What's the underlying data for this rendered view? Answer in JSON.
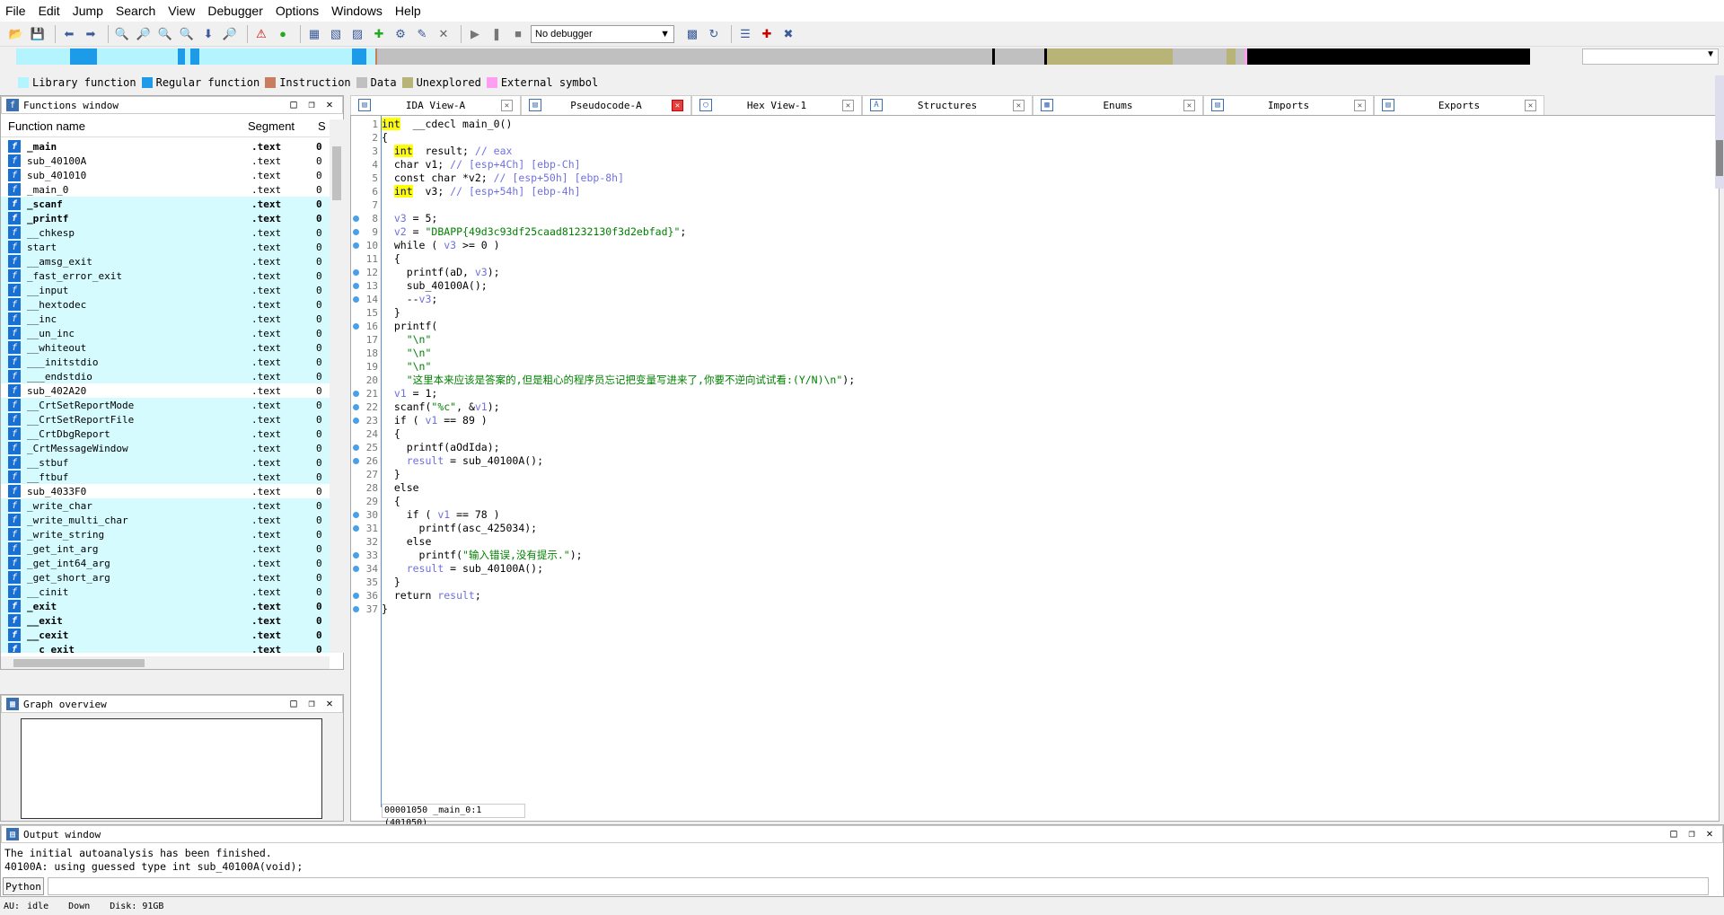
{
  "menubar": [
    "File",
    "Edit",
    "Jump",
    "Search",
    "View",
    "Debugger",
    "Options",
    "Windows",
    "Help"
  ],
  "toolbar": {
    "debugger_select": "No debugger"
  },
  "legend": [
    {
      "label": "Library function",
      "color": "#b4f4ff"
    },
    {
      "label": "Regular function",
      "color": "#1e9be8"
    },
    {
      "label": "Instruction",
      "color": "#c87e5e"
    },
    {
      "label": "Data",
      "color": "#c0c0c0"
    },
    {
      "label": "Unexplored",
      "color": "#b8b478"
    },
    {
      "label": "External symbol",
      "color": "#ff9ef0"
    }
  ],
  "functions_window": {
    "title": "Functions window",
    "col_name": "Function name",
    "col_segment": "Segment",
    "col_s": "S",
    "rows": [
      {
        "name": "_main",
        "seg": ".text",
        "s": "0",
        "lib": false,
        "bold": true
      },
      {
        "name": "sub_40100A",
        "seg": ".text",
        "s": "0",
        "lib": false,
        "bold": false
      },
      {
        "name": "sub_401010",
        "seg": ".text",
        "s": "0",
        "lib": false,
        "bold": false
      },
      {
        "name": "_main_0",
        "seg": ".text",
        "s": "0",
        "lib": false,
        "bold": false
      },
      {
        "name": "_scanf",
        "seg": ".text",
        "s": "0",
        "lib": true,
        "bold": true
      },
      {
        "name": "_printf",
        "seg": ".text",
        "s": "0",
        "lib": true,
        "bold": true
      },
      {
        "name": "__chkesp",
        "seg": ".text",
        "s": "0",
        "lib": true,
        "bold": false
      },
      {
        "name": "start",
        "seg": ".text",
        "s": "0",
        "lib": true,
        "bold": false
      },
      {
        "name": "__amsg_exit",
        "seg": ".text",
        "s": "0",
        "lib": true,
        "bold": false
      },
      {
        "name": "_fast_error_exit",
        "seg": ".text",
        "s": "0",
        "lib": true,
        "bold": false
      },
      {
        "name": "__input",
        "seg": ".text",
        "s": "0",
        "lib": true,
        "bold": false
      },
      {
        "name": "__hextodec",
        "seg": ".text",
        "s": "0",
        "lib": true,
        "bold": false
      },
      {
        "name": "__inc",
        "seg": ".text",
        "s": "0",
        "lib": true,
        "bold": false
      },
      {
        "name": "__un_inc",
        "seg": ".text",
        "s": "0",
        "lib": true,
        "bold": false
      },
      {
        "name": "__whiteout",
        "seg": ".text",
        "s": "0",
        "lib": true,
        "bold": false
      },
      {
        "name": "___initstdio",
        "seg": ".text",
        "s": "0",
        "lib": true,
        "bold": false
      },
      {
        "name": "___endstdio",
        "seg": ".text",
        "s": "0",
        "lib": true,
        "bold": false
      },
      {
        "name": "sub_402A20",
        "seg": ".text",
        "s": "0",
        "lib": false,
        "bold": false
      },
      {
        "name": "__CrtSetReportMode",
        "seg": ".text",
        "s": "0",
        "lib": true,
        "bold": false
      },
      {
        "name": "__CrtSetReportFile",
        "seg": ".text",
        "s": "0",
        "lib": true,
        "bold": false
      },
      {
        "name": "__CrtDbgReport",
        "seg": ".text",
        "s": "0",
        "lib": true,
        "bold": false
      },
      {
        "name": "_CrtMessageWindow",
        "seg": ".text",
        "s": "0",
        "lib": true,
        "bold": false
      },
      {
        "name": "__stbuf",
        "seg": ".text",
        "s": "0",
        "lib": true,
        "bold": false
      },
      {
        "name": "__ftbuf",
        "seg": ".text",
        "s": "0",
        "lib": true,
        "bold": false
      },
      {
        "name": "sub_4033F0",
        "seg": ".text",
        "s": "0",
        "lib": false,
        "bold": false
      },
      {
        "name": "_write_char",
        "seg": ".text",
        "s": "0",
        "lib": true,
        "bold": false
      },
      {
        "name": "_write_multi_char",
        "seg": ".text",
        "s": "0",
        "lib": true,
        "bold": false
      },
      {
        "name": "_write_string",
        "seg": ".text",
        "s": "0",
        "lib": true,
        "bold": false
      },
      {
        "name": "_get_int_arg",
        "seg": ".text",
        "s": "0",
        "lib": true,
        "bold": false
      },
      {
        "name": "_get_int64_arg",
        "seg": ".text",
        "s": "0",
        "lib": true,
        "bold": false
      },
      {
        "name": "_get_short_arg",
        "seg": ".text",
        "s": "0",
        "lib": true,
        "bold": false
      },
      {
        "name": "__cinit",
        "seg": ".text",
        "s": "0",
        "lib": true,
        "bold": false
      },
      {
        "name": "_exit",
        "seg": ".text",
        "s": "0",
        "lib": true,
        "bold": true
      },
      {
        "name": "__exit",
        "seg": ".text",
        "s": "0",
        "lib": true,
        "bold": true
      },
      {
        "name": "__cexit",
        "seg": ".text",
        "s": "0",
        "lib": true,
        "bold": true
      },
      {
        "name": "__c_exit",
        "seg": ".text",
        "s": "0",
        "lib": true,
        "bold": true
      }
    ]
  },
  "graph_overview": {
    "title": "Graph overview"
  },
  "tabs": [
    {
      "label": "IDA View-A",
      "active": false
    },
    {
      "label": "Pseudocode-A",
      "active": true
    },
    {
      "label": "Hex View-1",
      "active": false
    },
    {
      "label": "Structures",
      "active": false
    },
    {
      "label": "Enums",
      "active": false
    },
    {
      "label": "Imports",
      "active": false
    },
    {
      "label": "Exports",
      "active": false
    }
  ],
  "code": {
    "breakpoint_lines": [
      8,
      9,
      10,
      12,
      13,
      14,
      16,
      21,
      22,
      23,
      25,
      26,
      30,
      31,
      33,
      34,
      36,
      37
    ],
    "lines": [
      [
        [
          "ty",
          "int"
        ],
        [
          "",
          "  __cdecl main_0()"
        ]
      ],
      [
        [
          "",
          "{"
        ]
      ],
      [
        [
          "",
          "  "
        ],
        [
          "ty",
          "int"
        ],
        [
          "",
          "  result; "
        ],
        [
          "cm",
          "// eax"
        ]
      ],
      [
        [
          "",
          "  char v1; "
        ],
        [
          "cm",
          "// [esp+4Ch] [ebp-Ch]"
        ]
      ],
      [
        [
          "",
          "  const char *v2; "
        ],
        [
          "cm",
          "// [esp+50h] [ebp-8h]"
        ]
      ],
      [
        [
          "",
          "  "
        ],
        [
          "ty",
          "int"
        ],
        [
          "",
          "  v3; "
        ],
        [
          "cm",
          "// [esp+54h] [ebp-4h]"
        ]
      ],
      [
        [
          "",
          ""
        ]
      ],
      [
        [
          "",
          "  "
        ],
        [
          "gv",
          "v3"
        ],
        [
          "",
          " = 5;"
        ]
      ],
      [
        [
          "",
          "  "
        ],
        [
          "gv",
          "v2"
        ],
        [
          "",
          " = "
        ],
        [
          "st",
          "\"DBAPP{49d3c93df25caad81232130f3d2ebfad}\""
        ],
        [
          "",
          ";"
        ]
      ],
      [
        [
          "",
          "  while ( "
        ],
        [
          "gv",
          "v3"
        ],
        [
          "",
          " >= 0 )"
        ]
      ],
      [
        [
          "",
          "  {"
        ]
      ],
      [
        [
          "",
          "    printf(aD, "
        ],
        [
          "gv",
          "v3"
        ],
        [
          "",
          ");"
        ]
      ],
      [
        [
          "",
          "    sub_40100A();"
        ]
      ],
      [
        [
          "",
          "    --"
        ],
        [
          "gv",
          "v3"
        ],
        [
          "",
          ";"
        ]
      ],
      [
        [
          "",
          "  }"
        ]
      ],
      [
        [
          "",
          "  printf("
        ]
      ],
      [
        [
          "",
          "    "
        ],
        [
          "st",
          "\"\\n\""
        ]
      ],
      [
        [
          "",
          "    "
        ],
        [
          "st",
          "\"\\n\""
        ]
      ],
      [
        [
          "",
          "    "
        ],
        [
          "st",
          "\"\\n\""
        ]
      ],
      [
        [
          "",
          "    "
        ],
        [
          "st",
          "\"这里本来应该是答案的,但是粗心的程序员忘记把变量写进来了,你要不逆向试试看:(Y/N)\\n\""
        ],
        [
          "",
          ");"
        ]
      ],
      [
        [
          "",
          "  "
        ],
        [
          "gv",
          "v1"
        ],
        [
          "",
          " = 1;"
        ]
      ],
      [
        [
          "",
          "  scanf("
        ],
        [
          "st",
          "\"%c\""
        ],
        [
          "",
          ", &"
        ],
        [
          "gv",
          "v1"
        ],
        [
          "",
          ");"
        ]
      ],
      [
        [
          "",
          "  if ( "
        ],
        [
          "gv",
          "v1"
        ],
        [
          "",
          " == 89 )"
        ]
      ],
      [
        [
          "",
          "  {"
        ]
      ],
      [
        [
          "",
          "    printf(aOdIda);"
        ]
      ],
      [
        [
          "",
          "    "
        ],
        [
          "gv",
          "result"
        ],
        [
          "",
          " = sub_40100A();"
        ]
      ],
      [
        [
          "",
          "  }"
        ]
      ],
      [
        [
          "",
          "  else"
        ]
      ],
      [
        [
          "",
          "  {"
        ]
      ],
      [
        [
          "",
          "    if ( "
        ],
        [
          "gv",
          "v1"
        ],
        [
          "",
          " == 78 )"
        ]
      ],
      [
        [
          "",
          "      printf(asc_425034);"
        ]
      ],
      [
        [
          "",
          "    else"
        ]
      ],
      [
        [
          "",
          "      printf("
        ],
        [
          "st",
          "\"输入错误,没有提示.\""
        ],
        [
          "",
          ");"
        ]
      ],
      [
        [
          "",
          "    "
        ],
        [
          "gv",
          "result"
        ],
        [
          "",
          " = sub_40100A();"
        ]
      ],
      [
        [
          "",
          "  }"
        ]
      ],
      [
        [
          "",
          "  return "
        ],
        [
          "gv",
          "result"
        ],
        [
          "",
          ";"
        ]
      ],
      [
        [
          "",
          "}"
        ]
      ]
    ],
    "status": "00001050 _main_0:1 (401050)"
  },
  "output_window": {
    "title": "Output window",
    "lines": [
      "The initial autoanalysis has been finished.",
      "40100A: using guessed type int sub_40100A(void);"
    ],
    "python_label": "Python"
  },
  "statusbar": {
    "au": "AU:",
    "state": "idle",
    "dir": "Down",
    "disk": "Disk: 91GB"
  }
}
